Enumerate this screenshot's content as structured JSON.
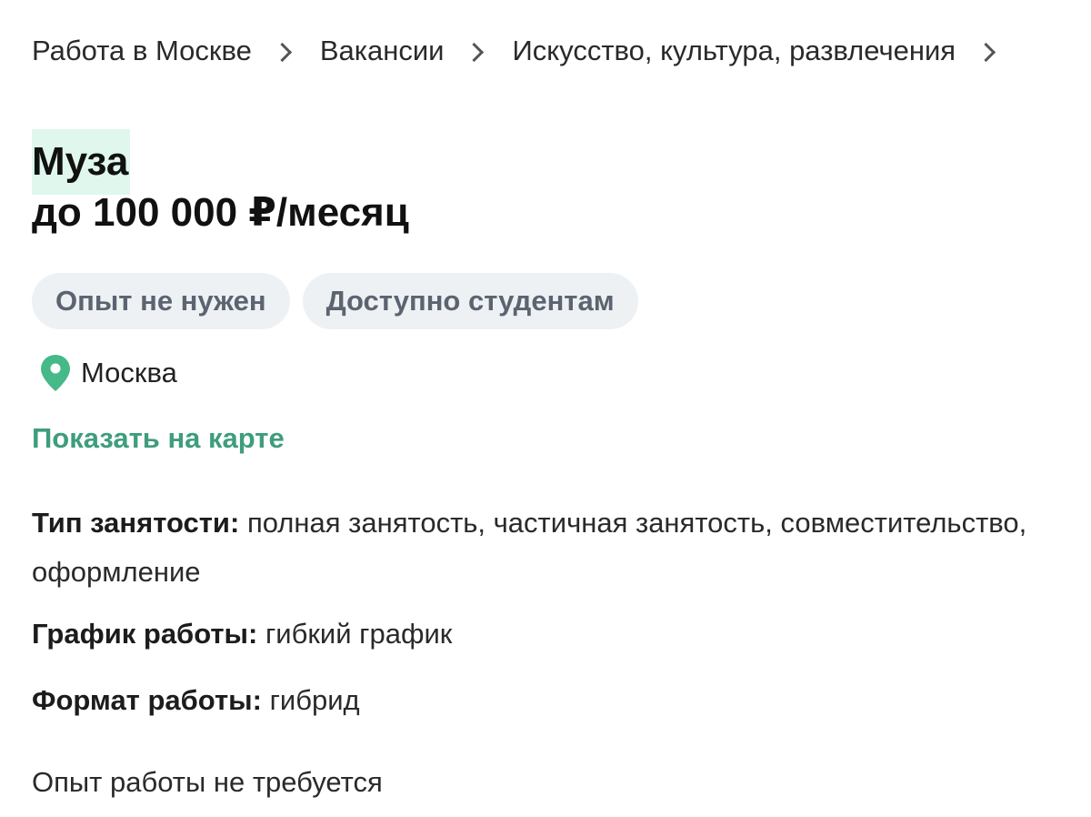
{
  "breadcrumb": {
    "items": [
      "Работа в Москве",
      "Вакансии",
      "Искусство, культура, развлечения"
    ]
  },
  "vacancy": {
    "title": "Муза",
    "salary": "до 100 000 ₽/месяц",
    "tags": [
      "Опыт не нужен",
      "Доступно студентам"
    ],
    "location": "Москва",
    "map_link": "Показать на карте",
    "employment_label": "Тип занятости:",
    "employment_value": "полная занятость, частичная занятость, совместительство, оформление",
    "schedule_label": "График работы:",
    "schedule_value": "гибкий график",
    "format_label": "Формат работы:",
    "format_value": "гибрид",
    "experience": "Опыт работы не требуется"
  },
  "colors": {
    "accent": "#3e9d7d",
    "title_highlight": "#dff7ec",
    "tag_background": "#eef1f4",
    "tag_text": "#5b6470"
  },
  "icons": {
    "location": "map-pin-icon",
    "breadcrumb_separator": "chevron-right-icon"
  }
}
